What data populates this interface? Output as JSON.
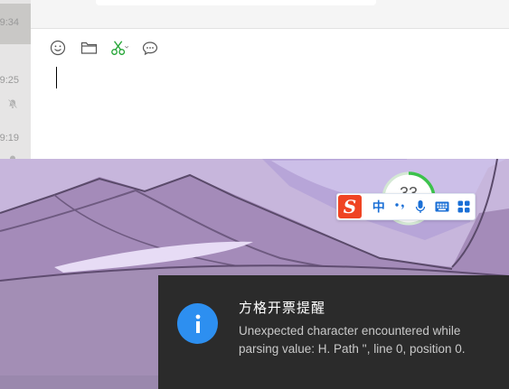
{
  "conversation_list": {
    "items": [
      {
        "time": "9:34",
        "active": true,
        "muted": false
      },
      {
        "time": "9:25",
        "active": false,
        "muted": true
      },
      {
        "time": "9:19",
        "active": false,
        "muted": true
      }
    ]
  },
  "composer": {
    "toolbar": [
      {
        "name": "emoji-icon"
      },
      {
        "name": "folder-icon"
      },
      {
        "name": "scissors-icon"
      },
      {
        "name": "chat-bubble-icon"
      }
    ]
  },
  "ime": {
    "logo": "S",
    "progress_value": "33",
    "buttons": [
      {
        "label": "中",
        "name": "ime-chinese-mode"
      },
      {
        "label": "•,",
        "name": "ime-punctuation"
      },
      {
        "label": "mic",
        "name": "ime-voice"
      },
      {
        "label": "keyboard",
        "name": "ime-keyboard"
      },
      {
        "label": "grid",
        "name": "ime-toolbox"
      }
    ]
  },
  "toast": {
    "title": "方格开票提醒",
    "message": "Unexpected character encountered while parsing value: H. Path '', line 0, position 0.",
    "icon": "info-icon",
    "accent_color": "#2d8ff0"
  },
  "colors": {
    "wallpaper_purple": "#a48bb9",
    "toast_bg": "#2b2b2b",
    "ime_red": "#ef4423",
    "ime_blue": "#1a6fd6"
  }
}
